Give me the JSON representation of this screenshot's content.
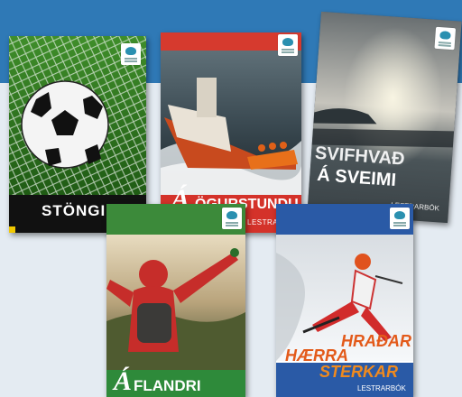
{
  "books": {
    "stongin": {
      "title": "STÖNGIN"
    },
    "stund": {
      "title_letter": "Á",
      "title_rest": "ÖGURSTUNDU",
      "subtitle": "LESTRARBÓK"
    },
    "svif": {
      "line1": "SVIFHVAÐ",
      "line2": "Á SVEIMI",
      "subtitle": "LESTRARBÓK"
    },
    "flandri": {
      "title_letter": "Á",
      "title_rest": "FLANDRI"
    },
    "hradar": {
      "word1": "HRAÐAR",
      "word2": "HÆRRA",
      "word3": "STERKAR",
      "subtitle": "LESTRARBÓK"
    }
  },
  "colors": {
    "band": "#2f79b6",
    "background": "#e4ebf2"
  }
}
